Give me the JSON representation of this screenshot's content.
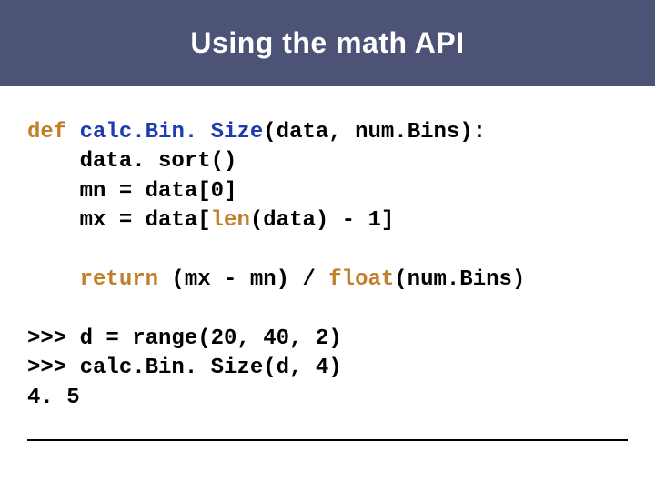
{
  "title": "Using the math API",
  "code": {
    "l1": {
      "def": "def",
      "fn": "calc.Bin. Size",
      "rest": "(data, num.Bins):"
    },
    "l2": "    data. sort()",
    "l3": "    mn = data[0]",
    "l4a": "    mx = data[",
    "l4_len": "len",
    "l4b": "(data) - 1]",
    "blank1": "",
    "l5a": "    ",
    "l5_return": "return",
    "l5b": " (mx - mn) / ",
    "l5_float": "float",
    "l5c": "(num.Bins)",
    "blank2": "",
    "l6": ">>> d = range(20, 40, 2)",
    "l7": ">>> calc.Bin. Size(d, 4)",
    "l8": "4. 5"
  }
}
